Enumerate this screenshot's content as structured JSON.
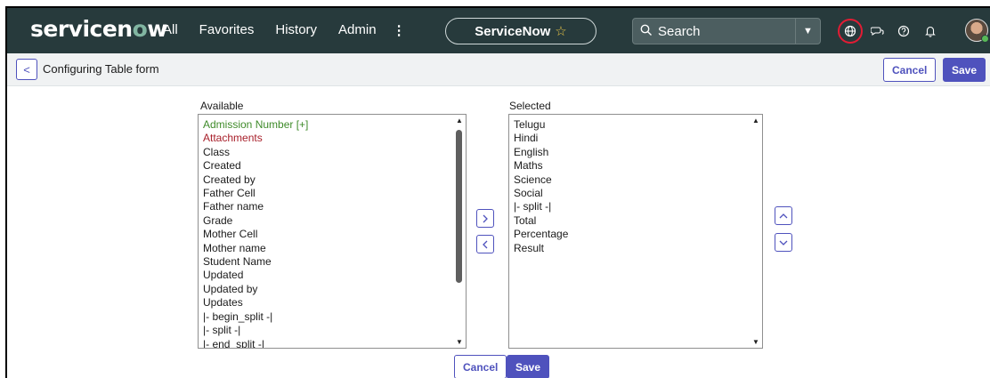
{
  "nav": {
    "logo_pre": "servicen",
    "logo_o": "o",
    "logo_post": "w",
    "links": [
      "All",
      "Favorites",
      "History",
      "Admin"
    ],
    "more_icon": "⋮",
    "context_label": "ServiceNow",
    "star_icon": "☆",
    "search_placeholder": "Search",
    "search_icon": "magnifier",
    "icons": [
      "globe-icon",
      "chat-icon",
      "help-icon",
      "bell-icon"
    ]
  },
  "header": {
    "back_icon": "<",
    "title": "Configuring Table form",
    "cancel_label": "Cancel",
    "save_label": "Save"
  },
  "available": {
    "label": "Available",
    "items": [
      {
        "text": "Admission Number [+]",
        "color": "green"
      },
      {
        "text": "Attachments",
        "color": "red"
      },
      {
        "text": "Class"
      },
      {
        "text": "Created"
      },
      {
        "text": "Created by"
      },
      {
        "text": "Father Cell"
      },
      {
        "text": "Father name"
      },
      {
        "text": "Grade"
      },
      {
        "text": "Mother Cell"
      },
      {
        "text": "Mother name"
      },
      {
        "text": "Student Name"
      },
      {
        "text": "Updated"
      },
      {
        "text": "Updated by"
      },
      {
        "text": "Updates"
      },
      {
        "text": "|- begin_split -|"
      },
      {
        "text": "|- split -|"
      },
      {
        "text": "|- end_split -|"
      }
    ]
  },
  "selected": {
    "label": "Selected",
    "items": [
      {
        "text": "Telugu"
      },
      {
        "text": "Hindi"
      },
      {
        "text": "English"
      },
      {
        "text": "Maths"
      },
      {
        "text": "Science"
      },
      {
        "text": "Social"
      },
      {
        "text": "|- split -|"
      },
      {
        "text": "Total"
      },
      {
        "text": "Percentage"
      },
      {
        "text": "Result"
      }
    ]
  },
  "footer": {
    "cancel_label": "Cancel",
    "save_label": "Save"
  },
  "colors": {
    "nav_bg": "#273a3c",
    "accent": "#4f52bd",
    "green_item": "#3f8b2a",
    "red_item": "#a8202b",
    "highlight_ring": "#e21c34"
  }
}
